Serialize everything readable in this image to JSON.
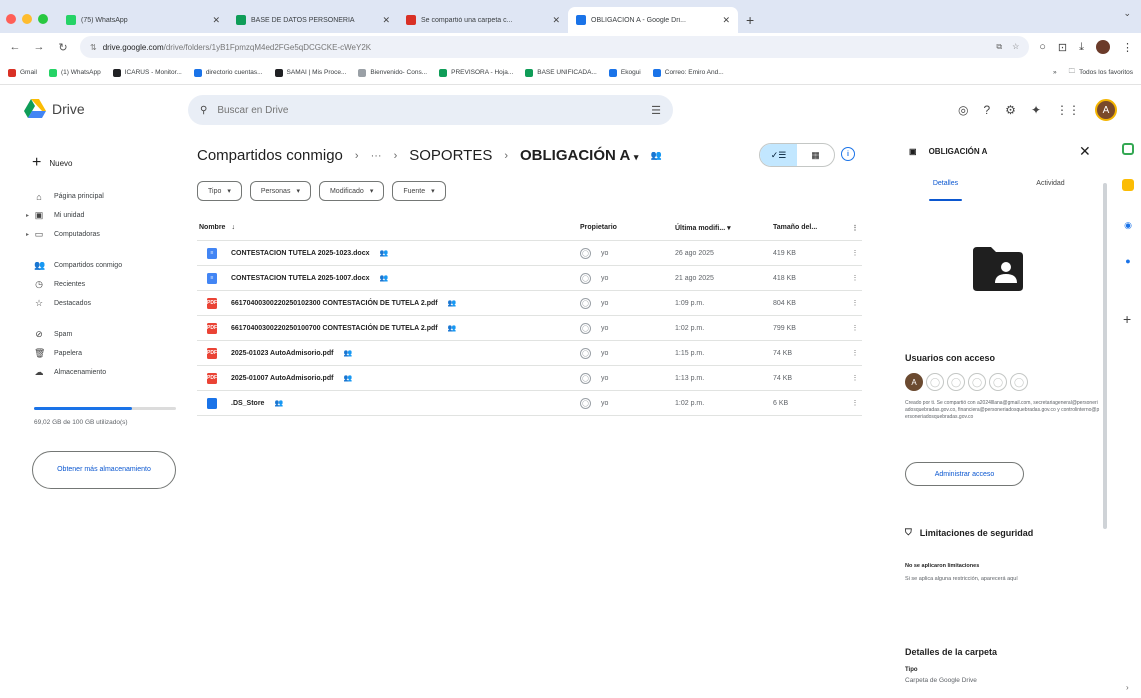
{
  "browser": {
    "tabs": [
      {
        "label": "(75) WhatsApp",
        "color": "#25d366",
        "active": false
      },
      {
        "label": "BASE DE DATOS PERSONERIA",
        "color": "#0f9d58",
        "active": false
      },
      {
        "label": "Se compartió una carpeta c...",
        "color": "#d93025",
        "active": false
      },
      {
        "label": "OBLIGACIÓN A - Google Dri...",
        "color": "#1a73e8",
        "active": true
      }
    ],
    "url_host": "drive.google.com",
    "url_path": "/drive/folders/1yB1FpmzqM4ed2FGe5qDCGCKE-cWeY2K",
    "bookmarks": [
      {
        "label": "Gmail",
        "color": "#d93025"
      },
      {
        "label": "(1) WhatsApp",
        "color": "#25d366"
      },
      {
        "label": "ICARUS - Monitor...",
        "color": "#202124"
      },
      {
        "label": "directorio cuentas...",
        "color": "#1a73e8"
      },
      {
        "label": "SAMAI | Mis Proce...",
        "color": "#202124"
      },
      {
        "label": "Bienvenido- Cons...",
        "color": "#9aa0a6"
      },
      {
        "label": "PREVISORA - Hoja...",
        "color": "#0f9d58"
      },
      {
        "label": "BASE UNIFICADA...",
        "color": "#0f9d58"
      },
      {
        "label": "Ekogui",
        "color": "#1a73e8"
      },
      {
        "label": "Correo: Emiro And...",
        "color": "#1a73e8"
      }
    ],
    "all_bookmarks": "Todos los favoritos"
  },
  "drive": {
    "logo_text": "Drive",
    "search_placeholder": "Buscar en Drive",
    "avatar_letter": "A"
  },
  "sidebar": {
    "new_label": "Nuevo",
    "items": [
      {
        "label": "Página principal",
        "icon": "home-icon",
        "glyph": "⌂"
      },
      {
        "label": "Mi unidad",
        "icon": "drive-icon",
        "glyph": "▣"
      },
      {
        "label": "Computadoras",
        "icon": "computer-icon",
        "glyph": "▭"
      },
      {
        "label": "Compartidos conmigo",
        "icon": "people-icon",
        "glyph": "👥"
      },
      {
        "label": "Recientes",
        "icon": "clock-icon",
        "glyph": "◷"
      },
      {
        "label": "Destacados",
        "icon": "star-icon",
        "glyph": "☆"
      },
      {
        "label": "Spam",
        "icon": "spam-icon",
        "glyph": "⊘"
      },
      {
        "label": "Papelera",
        "icon": "trash-icon",
        "glyph": "🗑"
      },
      {
        "label": "Almacenamiento",
        "icon": "cloud-icon",
        "glyph": "☁"
      }
    ],
    "storage_text": "69,02 GB de 100 GB utilizado(s)",
    "storage_fraction": 0.69,
    "more_storage_label": "Obtener más almacenamiento"
  },
  "main": {
    "breadcrumb": {
      "root": "Compartidos conmigo",
      "ellipsis": "···",
      "middle": "SOPORTES",
      "current": "OBLIGACIÓN A"
    },
    "filters": [
      "Tipo",
      "Personas",
      "Modificado",
      "Fuente"
    ],
    "columns": {
      "name": "Nombre",
      "owner": "Propietario",
      "modified": "Última modifi...",
      "size": "Tamaño del..."
    },
    "files": [
      {
        "name": "CONTESTACION TUTELA 2025-1023.docx",
        "type": "docx",
        "color": "#4285f4",
        "owner": "yo",
        "modified": "26 ago 2025",
        "size": "419 KB"
      },
      {
        "name": "CONTESTACION TUTELA 2025-1007.docx",
        "type": "docx",
        "color": "#4285f4",
        "owner": "yo",
        "modified": "21 ago 2025",
        "size": "418 KB"
      },
      {
        "name": "66170400300220250102300 CONTESTACIÓN DE TUTELA 2.pdf",
        "type": "pdf",
        "color": "#ea4335",
        "owner": "yo",
        "modified": "1:09 p.m.",
        "size": "804 KB"
      },
      {
        "name": "66170400300220250100700 CONTESTACIÓN DE TUTELA 2.pdf",
        "type": "pdf",
        "color": "#ea4335",
        "owner": "yo",
        "modified": "1:02 p.m.",
        "size": "799 KB"
      },
      {
        "name": "2025-01023 AutoAdmisorio.pdf",
        "type": "pdf",
        "color": "#ea4335",
        "owner": "yo",
        "modified": "1:15 p.m.",
        "size": "74 KB"
      },
      {
        "name": "2025-01007 AutoAdmisorio.pdf",
        "type": "pdf",
        "color": "#ea4335",
        "owner": "yo",
        "modified": "1:13 p.m.",
        "size": "74 KB"
      },
      {
        "name": ".DS_Store",
        "type": "file",
        "color": "#1a73e8",
        "owner": "yo",
        "modified": "1:02 p.m.",
        "size": "6 KB"
      }
    ]
  },
  "panel": {
    "title": "OBLIGACIÓN A",
    "tab_details": "Detalles",
    "tab_activity": "Actividad",
    "access_title": "Usuarios con acceso",
    "access_note": "Creado por ti. Se compartió con a2024lllana@gmail.com, secretariageneral@personeriadosquebradas.gov.co, financiera@personeriadosquebradas.gov.co y controlinterno@personeriadosquebradas.gov.co",
    "manage_label": "Administrar acceso",
    "security_title": "Limitaciones de seguridad",
    "security_line1": "No se aplicaron limitaciones",
    "security_line2": "Si se aplica alguna restricción, aparecerá aquí",
    "details_title": "Detalles de la carpeta",
    "type_label": "Tipo",
    "type_value": "Carpeta de Google Drive"
  }
}
